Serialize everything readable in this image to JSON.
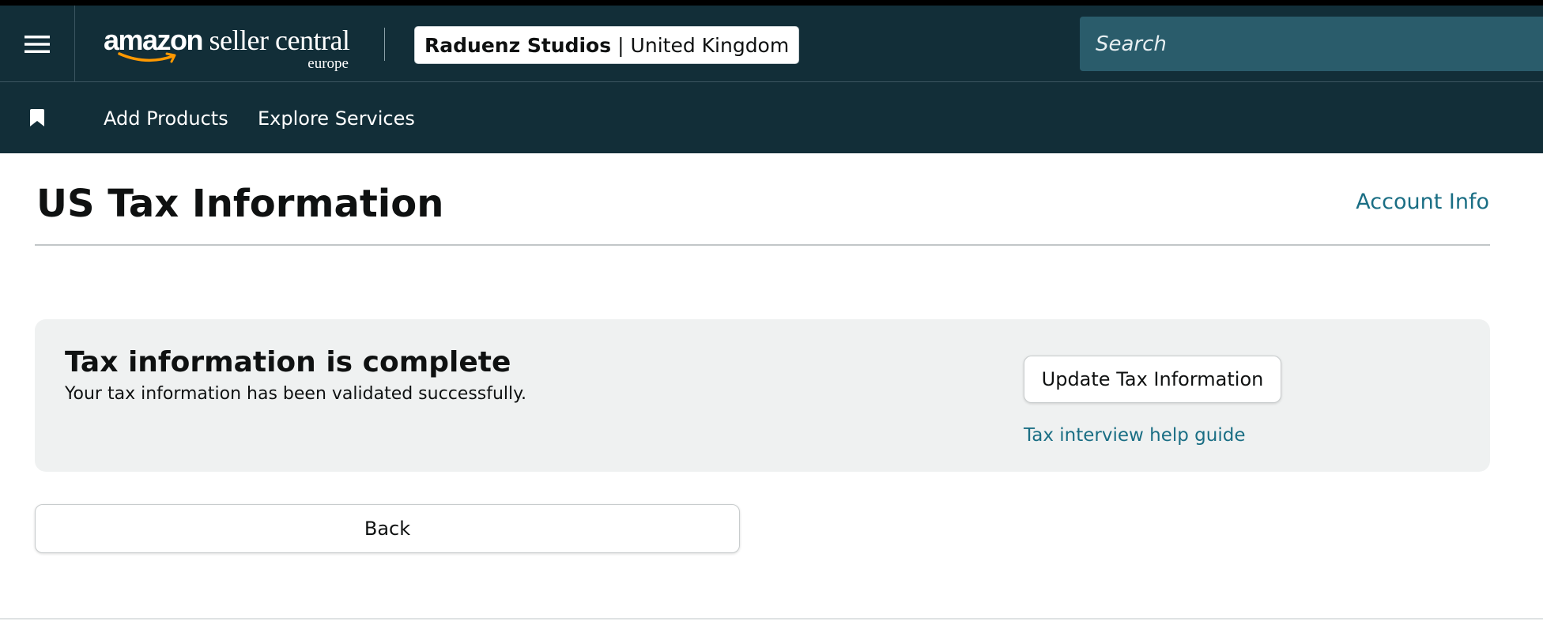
{
  "header": {
    "logo": {
      "brand_bold": "amazon",
      "brand_rest": " seller central",
      "region": "europe"
    },
    "account": {
      "store_name": "Raduenz Studios",
      "separator": "|",
      "country": "United Kingdom"
    },
    "search": {
      "placeholder": "Search"
    },
    "icons": {
      "menu": "hamburger-menu-icon",
      "bookmark": "bookmark-icon"
    }
  },
  "subnav": {
    "links": [
      {
        "label": "Add Products"
      },
      {
        "label": "Explore Services"
      }
    ]
  },
  "page": {
    "title": "US Tax Information",
    "account_info_link": "Account Info"
  },
  "status_card": {
    "heading": "Tax information is complete",
    "message": "Your tax information has been validated successfully.",
    "update_button": "Update Tax Information",
    "help_link": "Tax interview help guide"
  },
  "actions": {
    "back_button": "Back"
  },
  "colors": {
    "header_bg": "#122e38",
    "search_bg": "#2a5c6b",
    "link": "#1a6e84",
    "card_bg": "#eff1f1",
    "text": "#0f1111",
    "smile": "#ff9900"
  }
}
